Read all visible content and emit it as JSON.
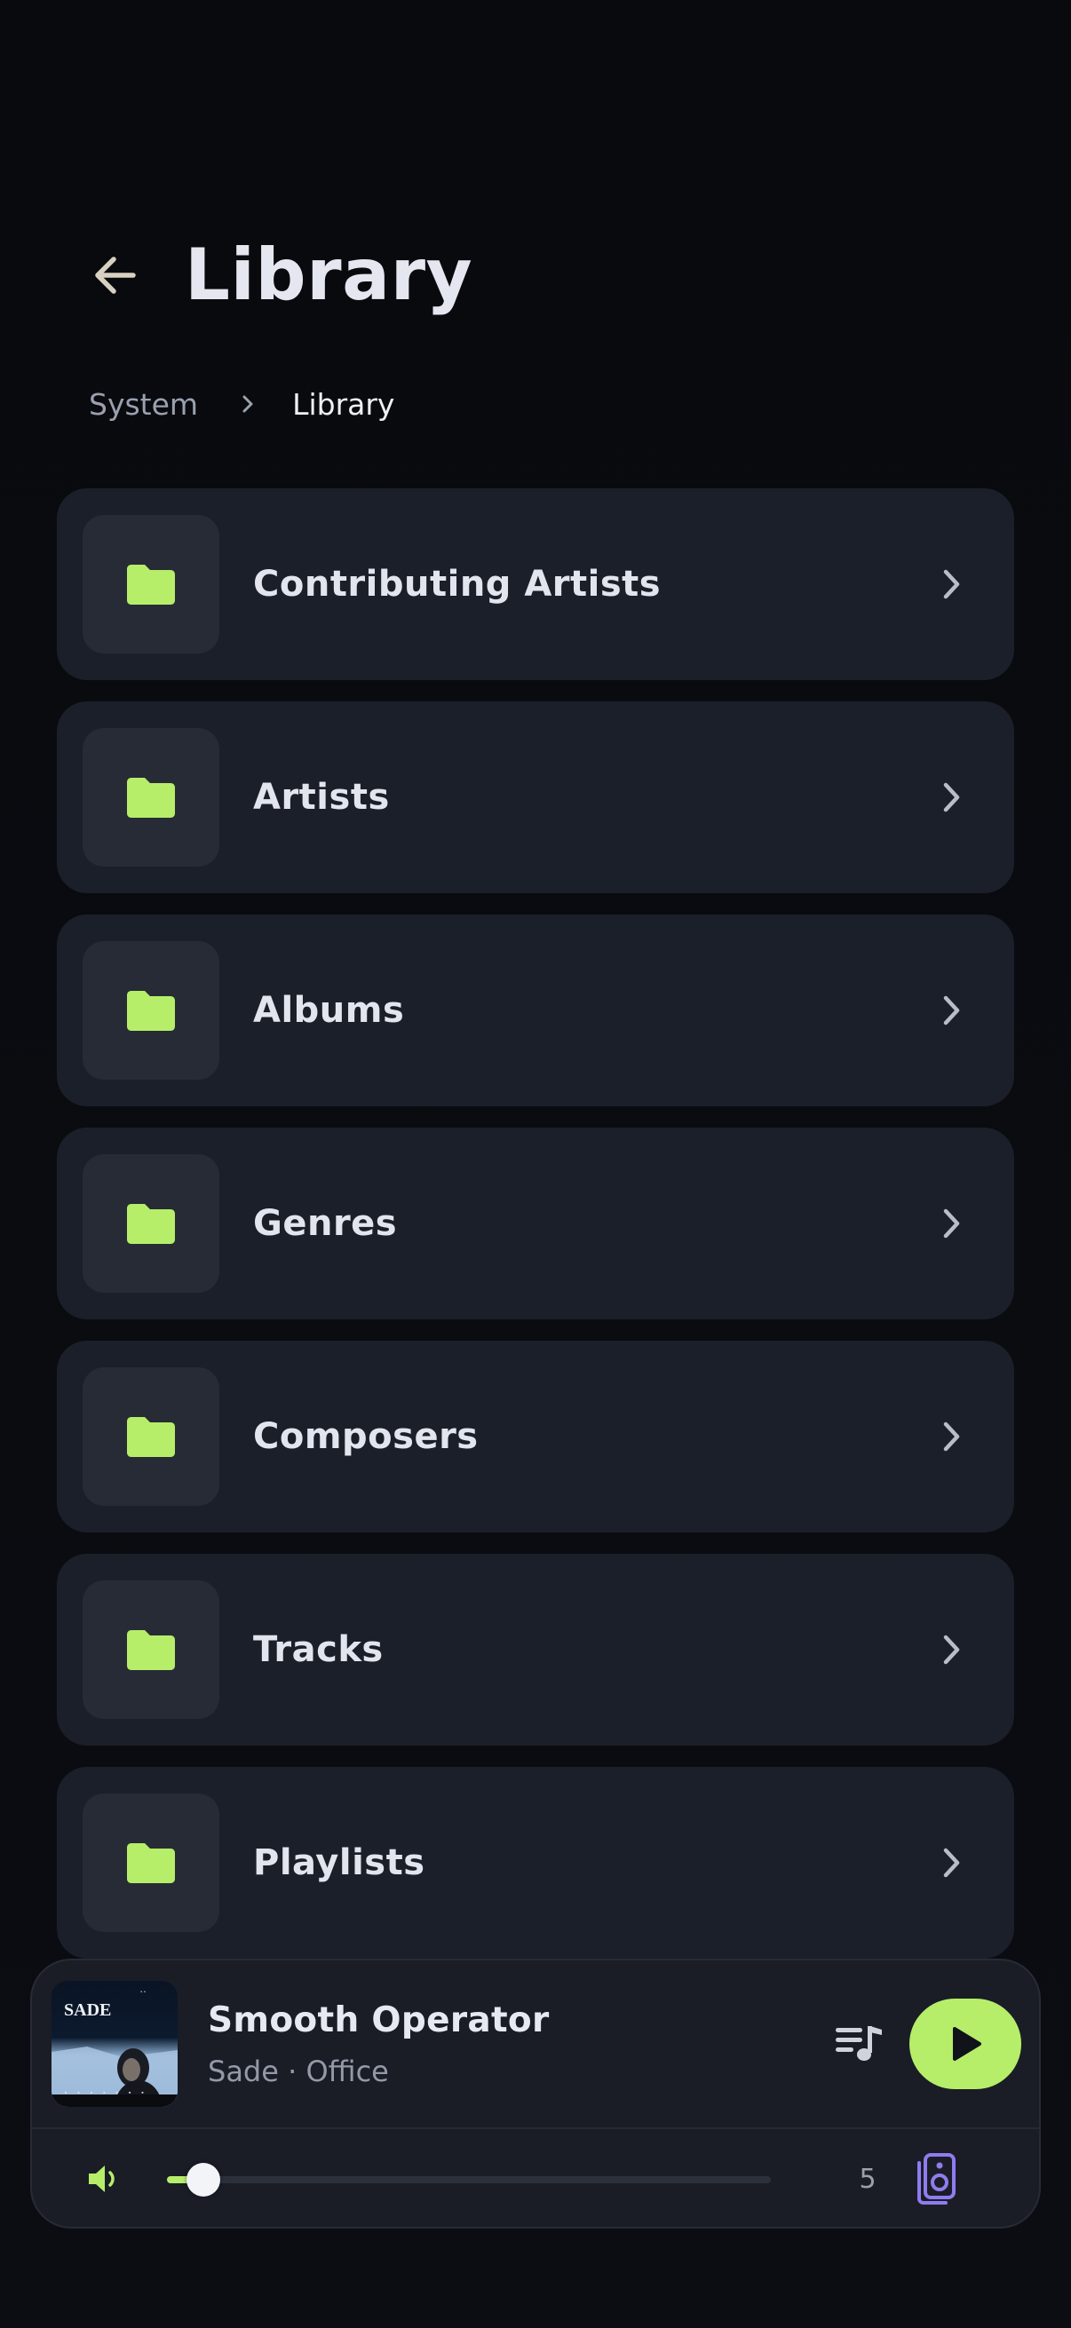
{
  "header": {
    "title": "Library",
    "back_icon": "arrow-left-icon"
  },
  "breadcrumb": {
    "items": [
      "System",
      "Library"
    ],
    "separator_icon": "chevron-right-icon"
  },
  "folders": [
    {
      "label": "Contributing Artists",
      "icon": "folder-icon"
    },
    {
      "label": "Artists",
      "icon": "folder-icon"
    },
    {
      "label": "Albums",
      "icon": "folder-icon"
    },
    {
      "label": "Genres",
      "icon": "folder-icon"
    },
    {
      "label": "Composers",
      "icon": "folder-icon"
    },
    {
      "label": "Tracks",
      "icon": "folder-icon"
    },
    {
      "label": "Playlists",
      "icon": "folder-icon"
    }
  ],
  "player": {
    "track_title": "Smooth Operator",
    "subtitle": "Sade · Office",
    "album_art_text": "SADE",
    "volume_value": "5",
    "volume_fraction": 0.04,
    "icons": {
      "queue": "queue-music-icon",
      "play": "play-icon",
      "volume": "volume-icon",
      "speaker": "speaker-icon"
    }
  },
  "colors": {
    "accent": "#b6ee6a",
    "speaker_accent": "#8e7cf0",
    "background": "#0a0b0f",
    "card": "#1b1f29",
    "icon_box": "#272b35",
    "text_primary": "#e2e5ee",
    "text_secondary": "#9aa1ae"
  }
}
